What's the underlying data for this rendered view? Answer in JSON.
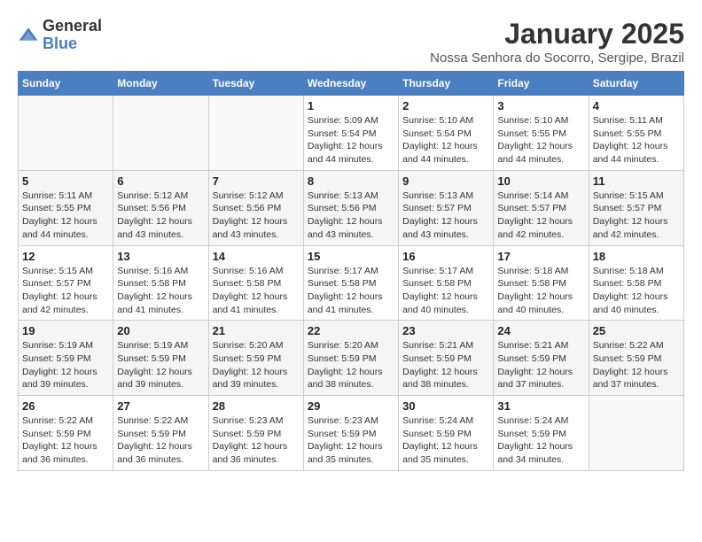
{
  "logo": {
    "general": "General",
    "blue": "Blue"
  },
  "header": {
    "month": "January 2025",
    "location": "Nossa Senhora do Socorro, Sergipe, Brazil"
  },
  "weekdays": [
    "Sunday",
    "Monday",
    "Tuesday",
    "Wednesday",
    "Thursday",
    "Friday",
    "Saturday"
  ],
  "weeks": [
    [
      {
        "day": "",
        "sunrise": "",
        "sunset": "",
        "daylight": ""
      },
      {
        "day": "",
        "sunrise": "",
        "sunset": "",
        "daylight": ""
      },
      {
        "day": "",
        "sunrise": "",
        "sunset": "",
        "daylight": ""
      },
      {
        "day": "1",
        "sunrise": "Sunrise: 5:09 AM",
        "sunset": "Sunset: 5:54 PM",
        "daylight": "Daylight: 12 hours and 44 minutes."
      },
      {
        "day": "2",
        "sunrise": "Sunrise: 5:10 AM",
        "sunset": "Sunset: 5:54 PM",
        "daylight": "Daylight: 12 hours and 44 minutes."
      },
      {
        "day": "3",
        "sunrise": "Sunrise: 5:10 AM",
        "sunset": "Sunset: 5:55 PM",
        "daylight": "Daylight: 12 hours and 44 minutes."
      },
      {
        "day": "4",
        "sunrise": "Sunrise: 5:11 AM",
        "sunset": "Sunset: 5:55 PM",
        "daylight": "Daylight: 12 hours and 44 minutes."
      }
    ],
    [
      {
        "day": "5",
        "sunrise": "Sunrise: 5:11 AM",
        "sunset": "Sunset: 5:55 PM",
        "daylight": "Daylight: 12 hours and 44 minutes."
      },
      {
        "day": "6",
        "sunrise": "Sunrise: 5:12 AM",
        "sunset": "Sunset: 5:56 PM",
        "daylight": "Daylight: 12 hours and 43 minutes."
      },
      {
        "day": "7",
        "sunrise": "Sunrise: 5:12 AM",
        "sunset": "Sunset: 5:56 PM",
        "daylight": "Daylight: 12 hours and 43 minutes."
      },
      {
        "day": "8",
        "sunrise": "Sunrise: 5:13 AM",
        "sunset": "Sunset: 5:56 PM",
        "daylight": "Daylight: 12 hours and 43 minutes."
      },
      {
        "day": "9",
        "sunrise": "Sunrise: 5:13 AM",
        "sunset": "Sunset: 5:57 PM",
        "daylight": "Daylight: 12 hours and 43 minutes."
      },
      {
        "day": "10",
        "sunrise": "Sunrise: 5:14 AM",
        "sunset": "Sunset: 5:57 PM",
        "daylight": "Daylight: 12 hours and 42 minutes."
      },
      {
        "day": "11",
        "sunrise": "Sunrise: 5:15 AM",
        "sunset": "Sunset: 5:57 PM",
        "daylight": "Daylight: 12 hours and 42 minutes."
      }
    ],
    [
      {
        "day": "12",
        "sunrise": "Sunrise: 5:15 AM",
        "sunset": "Sunset: 5:57 PM",
        "daylight": "Daylight: 12 hours and 42 minutes."
      },
      {
        "day": "13",
        "sunrise": "Sunrise: 5:16 AM",
        "sunset": "Sunset: 5:58 PM",
        "daylight": "Daylight: 12 hours and 41 minutes."
      },
      {
        "day": "14",
        "sunrise": "Sunrise: 5:16 AM",
        "sunset": "Sunset: 5:58 PM",
        "daylight": "Daylight: 12 hours and 41 minutes."
      },
      {
        "day": "15",
        "sunrise": "Sunrise: 5:17 AM",
        "sunset": "Sunset: 5:58 PM",
        "daylight": "Daylight: 12 hours and 41 minutes."
      },
      {
        "day": "16",
        "sunrise": "Sunrise: 5:17 AM",
        "sunset": "Sunset: 5:58 PM",
        "daylight": "Daylight: 12 hours and 40 minutes."
      },
      {
        "day": "17",
        "sunrise": "Sunrise: 5:18 AM",
        "sunset": "Sunset: 5:58 PM",
        "daylight": "Daylight: 12 hours and 40 minutes."
      },
      {
        "day": "18",
        "sunrise": "Sunrise: 5:18 AM",
        "sunset": "Sunset: 5:58 PM",
        "daylight": "Daylight: 12 hours and 40 minutes."
      }
    ],
    [
      {
        "day": "19",
        "sunrise": "Sunrise: 5:19 AM",
        "sunset": "Sunset: 5:59 PM",
        "daylight": "Daylight: 12 hours and 39 minutes."
      },
      {
        "day": "20",
        "sunrise": "Sunrise: 5:19 AM",
        "sunset": "Sunset: 5:59 PM",
        "daylight": "Daylight: 12 hours and 39 minutes."
      },
      {
        "day": "21",
        "sunrise": "Sunrise: 5:20 AM",
        "sunset": "Sunset: 5:59 PM",
        "daylight": "Daylight: 12 hours and 39 minutes."
      },
      {
        "day": "22",
        "sunrise": "Sunrise: 5:20 AM",
        "sunset": "Sunset: 5:59 PM",
        "daylight": "Daylight: 12 hours and 38 minutes."
      },
      {
        "day": "23",
        "sunrise": "Sunrise: 5:21 AM",
        "sunset": "Sunset: 5:59 PM",
        "daylight": "Daylight: 12 hours and 38 minutes."
      },
      {
        "day": "24",
        "sunrise": "Sunrise: 5:21 AM",
        "sunset": "Sunset: 5:59 PM",
        "daylight": "Daylight: 12 hours and 37 minutes."
      },
      {
        "day": "25",
        "sunrise": "Sunrise: 5:22 AM",
        "sunset": "Sunset: 5:59 PM",
        "daylight": "Daylight: 12 hours and 37 minutes."
      }
    ],
    [
      {
        "day": "26",
        "sunrise": "Sunrise: 5:22 AM",
        "sunset": "Sunset: 5:59 PM",
        "daylight": "Daylight: 12 hours and 36 minutes."
      },
      {
        "day": "27",
        "sunrise": "Sunrise: 5:22 AM",
        "sunset": "Sunset: 5:59 PM",
        "daylight": "Daylight: 12 hours and 36 minutes."
      },
      {
        "day": "28",
        "sunrise": "Sunrise: 5:23 AM",
        "sunset": "Sunset: 5:59 PM",
        "daylight": "Daylight: 12 hours and 36 minutes."
      },
      {
        "day": "29",
        "sunrise": "Sunrise: 5:23 AM",
        "sunset": "Sunset: 5:59 PM",
        "daylight": "Daylight: 12 hours and 35 minutes."
      },
      {
        "day": "30",
        "sunrise": "Sunrise: 5:24 AM",
        "sunset": "Sunset: 5:59 PM",
        "daylight": "Daylight: 12 hours and 35 minutes."
      },
      {
        "day": "31",
        "sunrise": "Sunrise: 5:24 AM",
        "sunset": "Sunset: 5:59 PM",
        "daylight": "Daylight: 12 hours and 34 minutes."
      },
      {
        "day": "",
        "sunrise": "",
        "sunset": "",
        "daylight": ""
      }
    ]
  ]
}
